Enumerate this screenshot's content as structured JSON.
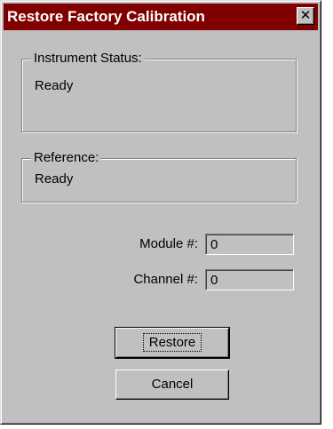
{
  "window": {
    "title": "Restore Factory Calibration",
    "close_glyph": "✕",
    "title_bar_color": "#800000",
    "face_color": "#c0c0c0"
  },
  "instrument_status": {
    "legend": "Instrument Status:",
    "value": "Ready"
  },
  "reference": {
    "legend": "Reference:",
    "value": "Ready"
  },
  "fields": {
    "module": {
      "label": "Module #:",
      "value": "0"
    },
    "channel": {
      "label": "Channel #:",
      "value": "0"
    }
  },
  "buttons": {
    "restore": "Restore",
    "cancel": "Cancel"
  }
}
